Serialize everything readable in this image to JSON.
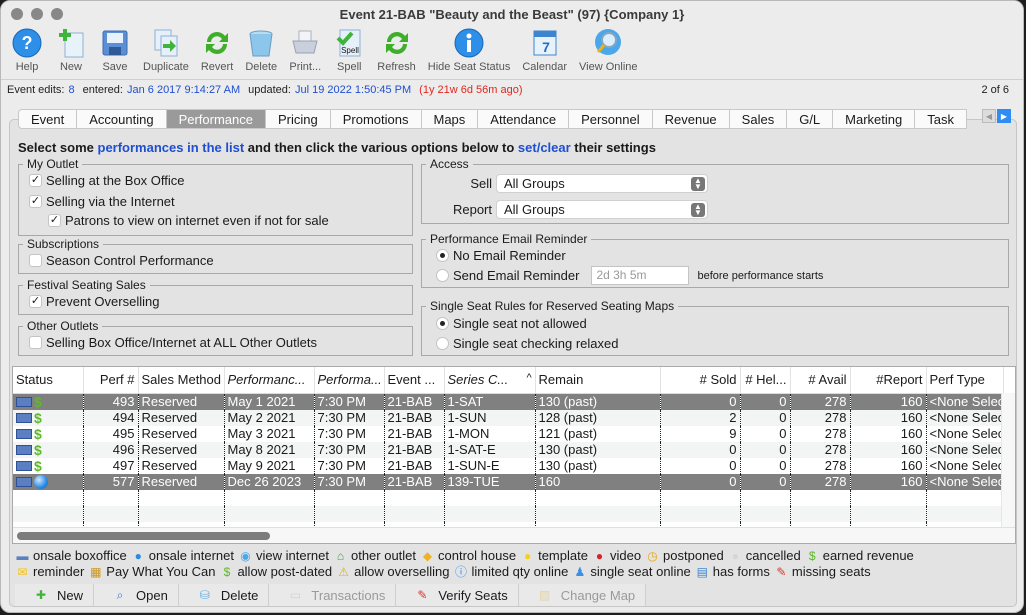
{
  "window": {
    "title": "Event 21-BAB \"Beauty and the Beast\" (97) {Company 1}"
  },
  "toolbar": {
    "buttons": [
      {
        "label": "Help",
        "icon": "help-icon"
      },
      {
        "label": "New",
        "icon": "new-document-icon"
      },
      {
        "label": "Save",
        "icon": "save-disk-icon"
      },
      {
        "label": "Duplicate",
        "icon": "duplicate-icon"
      },
      {
        "label": "Revert",
        "icon": "revert-arrows-icon"
      },
      {
        "label": "Delete",
        "icon": "trash-can-icon"
      },
      {
        "label": "Print...",
        "icon": "printer-icon"
      },
      {
        "label": "Spell",
        "icon": "spell-check-icon",
        "icon_text": "Spell"
      },
      {
        "label": "Refresh",
        "icon": "refresh-arrows-icon"
      },
      {
        "label": "Hide Seat Status",
        "icon": "info-icon"
      },
      {
        "label": "Calendar",
        "icon": "calendar-icon",
        "icon_text": "7"
      },
      {
        "label": "View Online",
        "icon": "view-online-magnifier-icon"
      }
    ]
  },
  "statusline": {
    "edits_label": "Event edits:",
    "edits_value": "8",
    "entered_label": "entered:",
    "entered_value": "Jan 6 2017 9:14:27 AM",
    "updated_label": "updated:",
    "updated_value": "Jul 19 2022 1:50:45 PM",
    "ago": "(1y 21w 6d 56m ago)",
    "pager": "2 of 6"
  },
  "tabs": [
    {
      "label": "Event"
    },
    {
      "label": "Accounting"
    },
    {
      "label": "Performance",
      "active": true
    },
    {
      "label": "Pricing"
    },
    {
      "label": "Promotions"
    },
    {
      "label": "Maps"
    },
    {
      "label": "Attendance"
    },
    {
      "label": "Personnel"
    },
    {
      "label": "Revenue"
    },
    {
      "label": "Sales"
    },
    {
      "label": "G/L"
    },
    {
      "label": "Marketing"
    },
    {
      "label": "Task"
    }
  ],
  "instructions": {
    "part1": "Select some ",
    "link1": "performances in the list",
    "part2": " and then click the various options below to ",
    "link2": "set/clear",
    "part3": " their settings"
  },
  "my_outlet": {
    "title": "My Outlet",
    "box_office": {
      "label": "Selling at the Box Office",
      "checked": true
    },
    "internet": {
      "label": "Selling via the Internet",
      "checked": true
    },
    "view_internet": {
      "label": "Patrons to view on internet even if not for sale",
      "checked": true
    }
  },
  "subscriptions": {
    "title": "Subscriptions",
    "season_control": {
      "label": "Season Control Performance",
      "checked": false
    }
  },
  "festival": {
    "title": "Festival Seating Sales",
    "prevent_overselling": {
      "label": "Prevent Overselling",
      "checked": true
    }
  },
  "other_outlets": {
    "title": "Other Outlets",
    "all_outlets": {
      "label": "Selling Box Office/Internet at ALL Other Outlets",
      "checked": false
    }
  },
  "access": {
    "title": "Access",
    "sell_label": "Sell",
    "sell_value": "All Groups",
    "report_label": "Report",
    "report_value": "All Groups"
  },
  "email_reminder": {
    "title": "Performance Email Reminder",
    "no_reminder": {
      "label": "No Email Reminder",
      "selected": true
    },
    "send_reminder": {
      "label": "Send Email Reminder",
      "selected": false
    },
    "duration_placeholder": "2d 3h 5m",
    "suffix": "before performance starts"
  },
  "single_seat": {
    "title": "Single Seat Rules for Reserved Seating Maps",
    "not_allowed": {
      "label": "Single seat not allowed",
      "selected": true
    },
    "relaxed": {
      "label": "Single seat checking relaxed",
      "selected": false
    }
  },
  "table": {
    "columns": [
      "Status",
      "Perf #",
      "Sales Method",
      "Performanc...",
      "Performa...",
      "Event ...",
      "Series C...",
      "Remain",
      "# Sold",
      "# Hel...",
      "# Avail",
      "#Report",
      "Perf Type"
    ],
    "sort_indicator": "^",
    "rows": [
      {
        "status": [
          "onsale-boxoffice",
          "earned-revenue"
        ],
        "perf": "493",
        "method": "Reserved",
        "date": "May 1 2021",
        "time": "7:30 PM",
        "event": "21-BAB",
        "series": "1-SAT",
        "remain": "130 (past)",
        "sold": "0",
        "held": "0",
        "avail": "278",
        "report": "160",
        "type": "<None Selec",
        "selected": true
      },
      {
        "status": [
          "onsale-boxoffice",
          "earned-revenue"
        ],
        "perf": "494",
        "method": "Reserved",
        "date": "May 2 2021",
        "time": "7:30 PM",
        "event": "21-BAB",
        "series": "1-SUN",
        "remain": "128 (past)",
        "sold": "2",
        "held": "0",
        "avail": "278",
        "report": "160",
        "type": "<None Selec",
        "selected": false
      },
      {
        "status": [
          "onsale-boxoffice",
          "earned-revenue"
        ],
        "perf": "495",
        "method": "Reserved",
        "date": "May 3 2021",
        "time": "7:30 PM",
        "event": "21-BAB",
        "series": "1-MON",
        "remain": "121 (past)",
        "sold": "9",
        "held": "0",
        "avail": "278",
        "report": "160",
        "type": "<None Selec",
        "selected": false
      },
      {
        "status": [
          "onsale-boxoffice",
          "earned-revenue"
        ],
        "perf": "496",
        "method": "Reserved",
        "date": "May 8 2021",
        "time": "7:30 PM",
        "event": "21-BAB",
        "series": "1-SAT-E",
        "remain": "130 (past)",
        "sold": "0",
        "held": "0",
        "avail": "278",
        "report": "160",
        "type": "<None Selec",
        "selected": false
      },
      {
        "status": [
          "onsale-boxoffice",
          "earned-revenue"
        ],
        "perf": "497",
        "method": "Reserved",
        "date": "May 9 2021",
        "time": "7:30 PM",
        "event": "21-BAB",
        "series": "1-SUN-E",
        "remain": "130 (past)",
        "sold": "0",
        "held": "0",
        "avail": "278",
        "report": "160",
        "type": "<None Selec",
        "selected": false
      },
      {
        "status": [
          "onsale-boxoffice",
          "onsale-internet"
        ],
        "perf": "577",
        "method": "Reserved",
        "date": "Dec 26 2023",
        "time": "7:30 PM",
        "event": "21-BAB",
        "series": "139-TUE",
        "remain": "160",
        "sold": "0",
        "held": "0",
        "avail": "278",
        "report": "160",
        "type": "<None Selec",
        "selected": true
      }
    ]
  },
  "legend": {
    "line1": [
      {
        "icon": "onsale-boxoffice-icon",
        "label": "onsale boxoffice"
      },
      {
        "icon": "onsale-internet-globe-icon",
        "label": "onsale internet"
      },
      {
        "icon": "view-internet-icon",
        "label": "view internet"
      },
      {
        "icon": "other-outlet-house-icon",
        "label": "other outlet"
      },
      {
        "icon": "control-house-icon",
        "label": "control house"
      },
      {
        "icon": "template-circle-icon",
        "label": "template"
      },
      {
        "icon": "video-icon",
        "label": "video"
      },
      {
        "icon": "postponed-clock-icon",
        "label": "postponed"
      },
      {
        "icon": "cancelled-circle-icon",
        "label": "cancelled"
      },
      {
        "icon": "earned-revenue-dollar-icon",
        "label": "earned revenue"
      }
    ],
    "line2": [
      {
        "icon": "reminder-envelope-icon",
        "label": "reminder"
      },
      {
        "icon": "pay-what-you-can-coins-icon",
        "label": "Pay What You Can"
      },
      {
        "icon": "post-dated-dollar-icon",
        "label": "allow post-dated"
      },
      {
        "icon": "warning-triangle-icon",
        "label": "allow overselling"
      },
      {
        "icon": "limited-qty-info-icon",
        "label": "limited qty online"
      },
      {
        "icon": "single-seat-online-icon",
        "label": "single seat online"
      },
      {
        "icon": "has-forms-icon",
        "label": "has forms"
      },
      {
        "icon": "missing-seats-icon",
        "label": "missing seats"
      }
    ]
  },
  "bottom_buttons": [
    {
      "label": "New",
      "icon": "new-document-icon",
      "enabled": true
    },
    {
      "label": "Open",
      "icon": "open-magnifier-icon",
      "enabled": true
    },
    {
      "label": "Delete",
      "icon": "trash-can-icon",
      "enabled": true
    },
    {
      "label": "Transactions",
      "icon": "transactions-icon",
      "enabled": false
    },
    {
      "label": "Verify Seats",
      "icon": "verify-seats-icon",
      "enabled": true
    },
    {
      "label": "Change Map",
      "icon": "change-map-icon",
      "enabled": false
    }
  ],
  "colors": {
    "link_blue": "#1f4fd1",
    "ago_red": "#e0281d",
    "selected_row": "#808080",
    "active_tab": "#9a9a9a"
  }
}
